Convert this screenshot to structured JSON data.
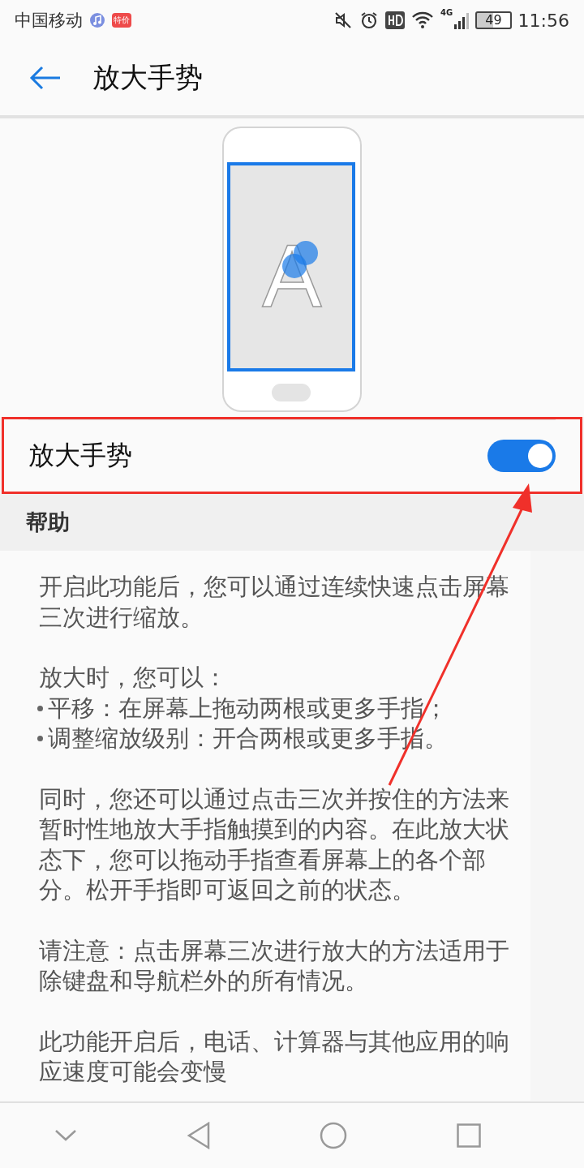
{
  "status_bar": {
    "carrier": "中国移动",
    "app_badge": "特价",
    "battery": "49",
    "network": "4G",
    "time": "11:56"
  },
  "header": {
    "title": "放大手势"
  },
  "illustration": {
    "letter": "A"
  },
  "setting": {
    "label": "放大手势",
    "on": true
  },
  "help": {
    "title": "帮助",
    "blocks": [
      {
        "kind": "para",
        "text": "开启此功能后，您可以通过连续快速点击屏幕三次进行缩放。"
      },
      {
        "kind": "para",
        "text": "放大时，您可以："
      },
      {
        "kind": "bullet",
        "text": "平移：在屏幕上拖动两根或更多手指；"
      },
      {
        "kind": "bullet",
        "text": "调整缩放级别：开合两根或更多手指。"
      },
      {
        "kind": "para",
        "text": "同时，您还可以通过点击三次并按住的方法来暂时性地放大手指触摸到的内容。在此放大状态下，您可以拖动手指查看屏幕上的各个部分。松开手指即可返回之前的状态。"
      },
      {
        "kind": "para",
        "text": "请注意：点击屏幕三次进行放大的方法适用于除键盘和导航栏外的所有情况。"
      },
      {
        "kind": "para",
        "text": "此功能开启后，电话、计算器与其他应用的响应速度可能会变慢"
      }
    ]
  },
  "annotation": {
    "highlight_frame": true,
    "arrow": true
  }
}
